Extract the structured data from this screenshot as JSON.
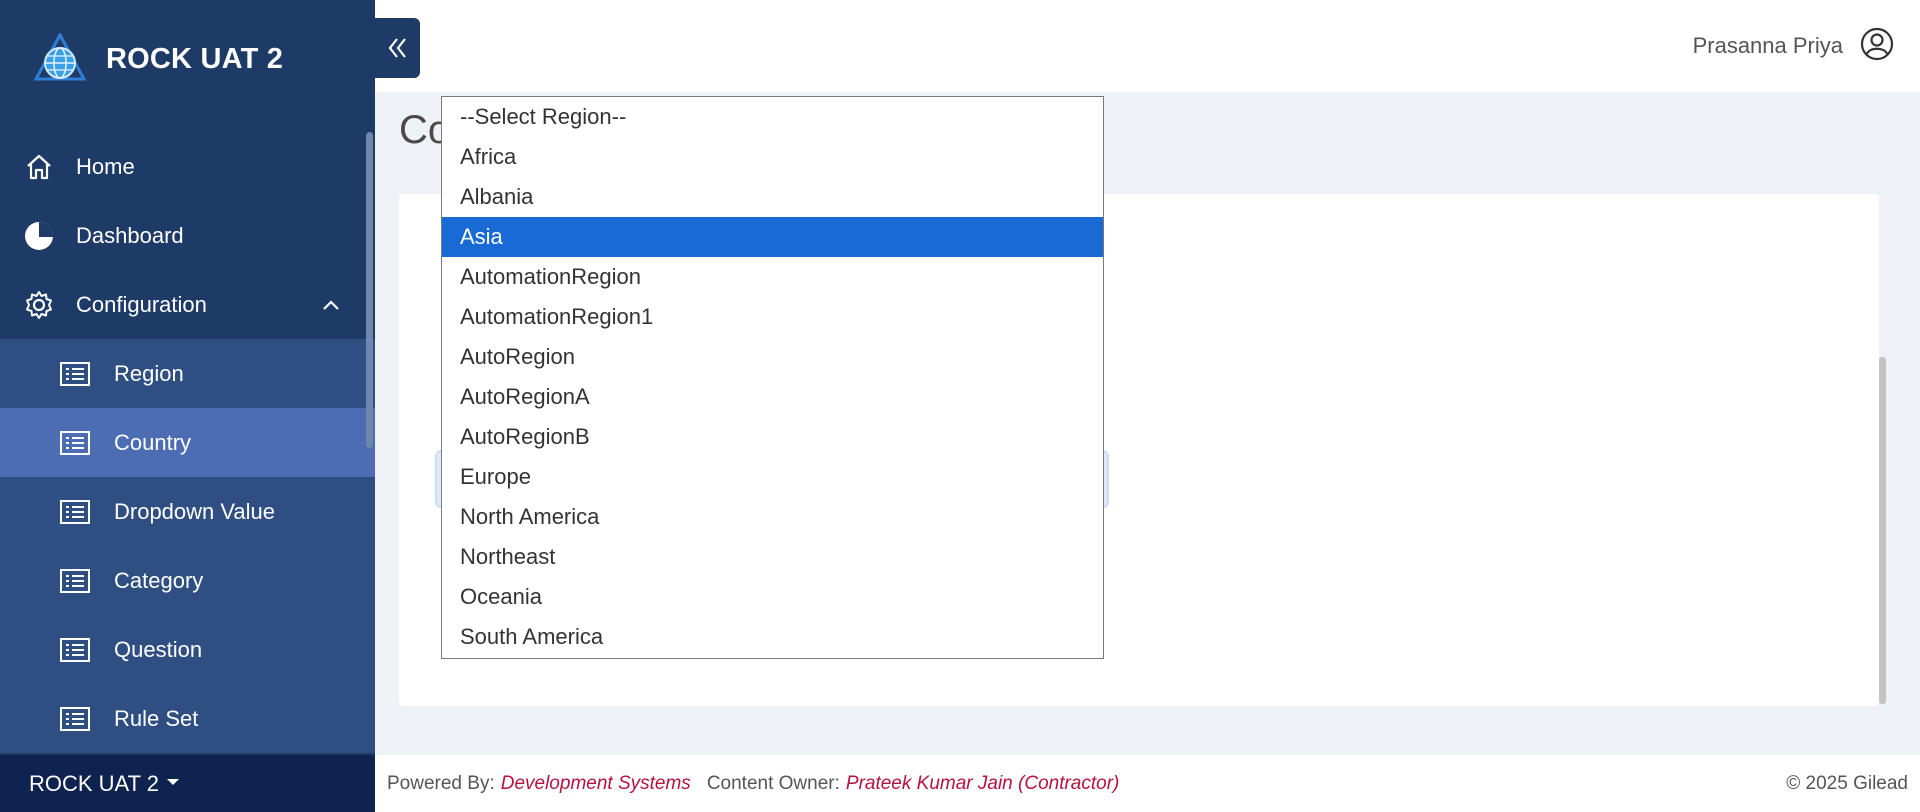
{
  "app": {
    "name": "ROCK UAT 2"
  },
  "header": {
    "user_name": "Prasanna Priya"
  },
  "sidebar": {
    "items": [
      {
        "label": "Home"
      },
      {
        "label": "Dashboard"
      },
      {
        "label": "Configuration"
      },
      {
        "label": "Region"
      },
      {
        "label": "Country"
      },
      {
        "label": "Dropdown Value"
      },
      {
        "label": "Category"
      },
      {
        "label": "Question"
      },
      {
        "label": "Rule Set"
      }
    ],
    "footer_label": "ROCK UAT 2"
  },
  "main": {
    "title_partial": "Co"
  },
  "dropdown": {
    "options": [
      "--Select Region--",
      "Africa",
      "Albania",
      "Asia",
      "AutomationRegion",
      "AutomationRegion1",
      "AutoRegion",
      "AutoRegionA",
      "AutoRegionB",
      "Europe",
      "North America",
      "Northeast",
      "Oceania",
      "South America"
    ],
    "selected": "Asia"
  },
  "footer": {
    "powered_by_label": "Powered By:",
    "powered_by_value": "Development Systems",
    "owner_label": "Content Owner:",
    "owner_value": "Prateek Kumar Jain (Contractor)",
    "copyright": "© 2025 Gilead"
  },
  "colors": {
    "sidebar": "#1e3a66",
    "active": "#4c6cb3",
    "accent_link": "#b5123f",
    "selection": "#1a6ad6"
  }
}
